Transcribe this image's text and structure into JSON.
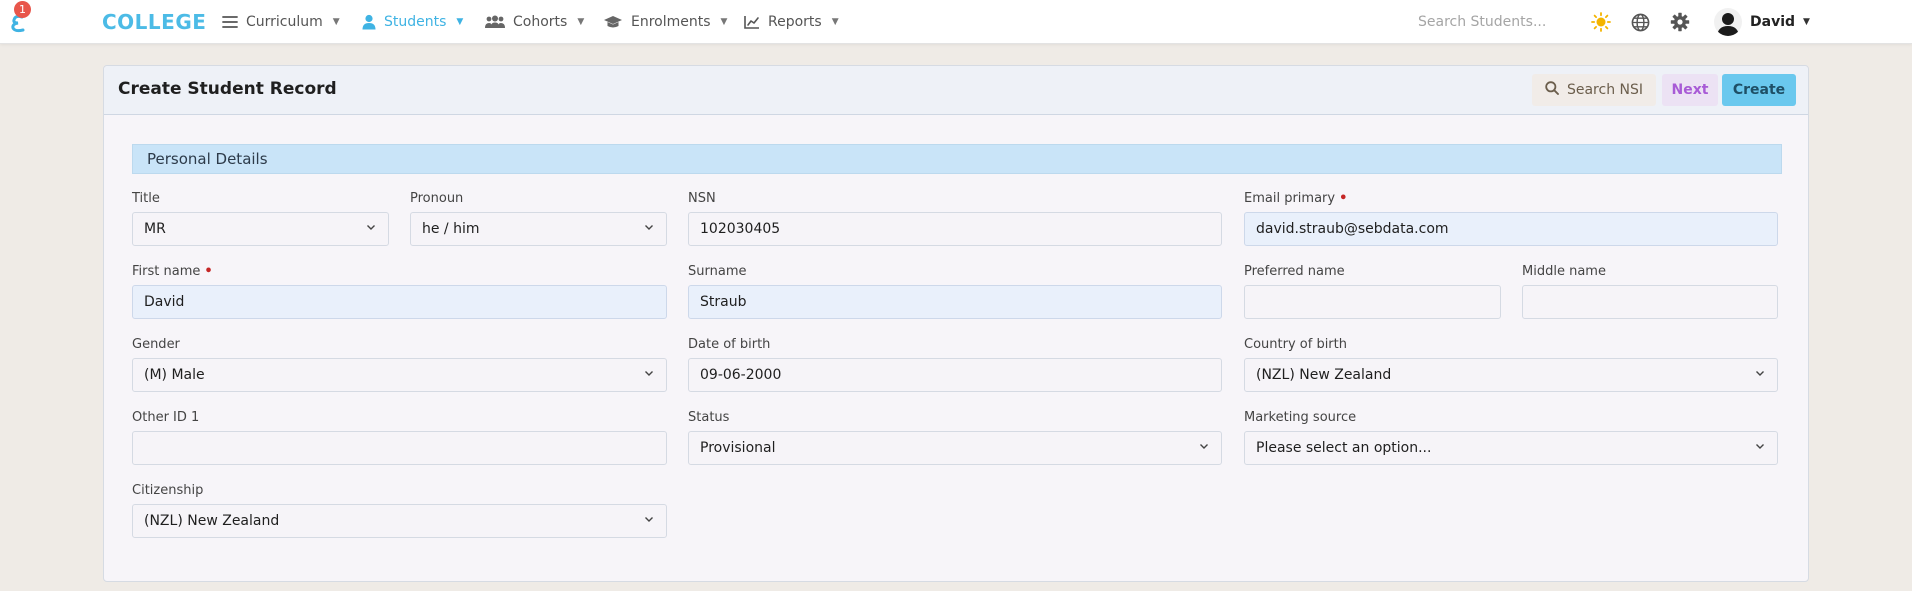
{
  "nav": {
    "badge_count": "1",
    "brand": "COLLEGE",
    "items": [
      {
        "label": "Curriculum",
        "icon": "menu-lines-icon",
        "active": false
      },
      {
        "label": "Students",
        "icon": "user-icon",
        "active": true
      },
      {
        "label": "Cohorts",
        "icon": "users-icon",
        "active": false
      },
      {
        "label": "Enrolments",
        "icon": "graduation-cap-icon",
        "active": false
      },
      {
        "label": "Reports",
        "icon": "line-chart-icon",
        "active": false
      }
    ],
    "search_placeholder": "Search Students...",
    "user_name": "David",
    "accent_color": "#3fb3e3"
  },
  "card": {
    "title": "Create Student Record",
    "buttons": {
      "search": "Search NSI",
      "next": "Next",
      "create": "Create"
    },
    "section_title": "Personal Details"
  },
  "form": {
    "title": {
      "label": "Title",
      "value": "MR"
    },
    "pronoun": {
      "label": "Pronoun",
      "value": "he / him"
    },
    "nsn": {
      "label": "NSN",
      "value": "102030405"
    },
    "email_primary": {
      "label": "Email primary",
      "value": "david.straub@sebdata.com",
      "required": true
    },
    "first_name": {
      "label": "First name",
      "value": "David",
      "required": true
    },
    "surname": {
      "label": "Surname",
      "value": "Straub"
    },
    "preferred_name": {
      "label": "Preferred name",
      "value": ""
    },
    "middle_name": {
      "label": "Middle name",
      "value": ""
    },
    "gender": {
      "label": "Gender",
      "value": "(M) Male"
    },
    "date_of_birth": {
      "label": "Date of birth",
      "value": "09-06-2000"
    },
    "country_of_birth": {
      "label": "Country of birth",
      "value": "(NZL) New Zealand"
    },
    "other_id_1": {
      "label": "Other ID 1",
      "value": ""
    },
    "status": {
      "label": "Status",
      "value": "Provisional"
    },
    "marketing_source": {
      "label": "Marketing source",
      "value": "Please select an option..."
    },
    "citizenship": {
      "label": "Citizenship",
      "value": "(NZL) New Zealand"
    }
  }
}
